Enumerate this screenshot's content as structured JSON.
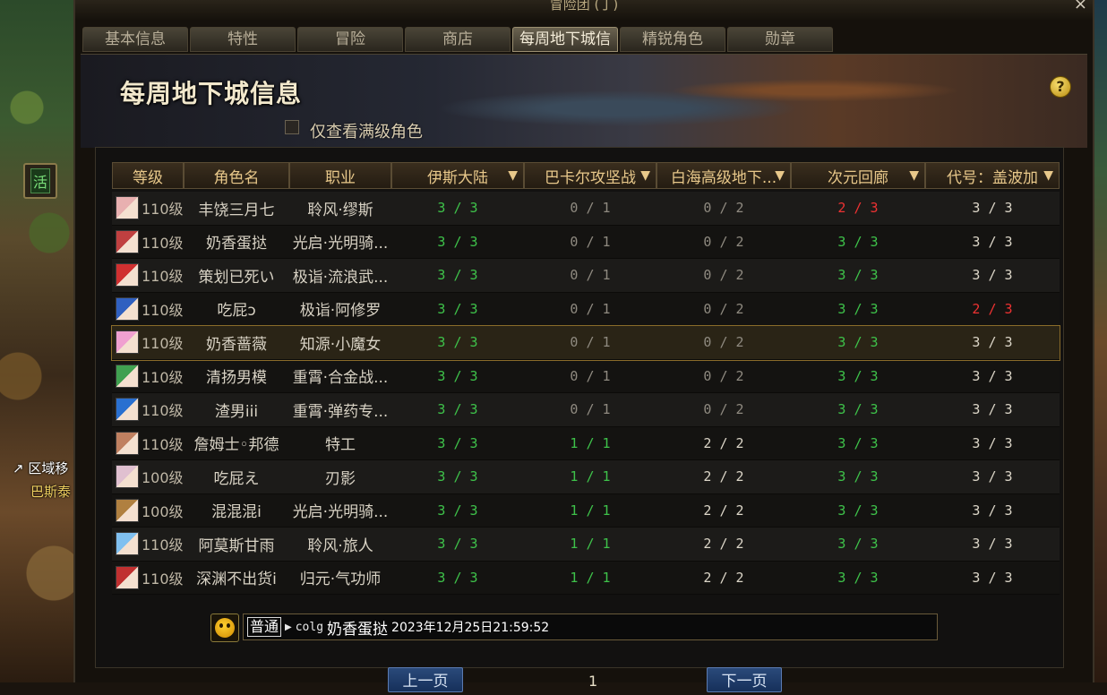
{
  "window": {
    "title": "冒险团 (丁)",
    "close_glyph": "×"
  },
  "tabs": [
    {
      "label": "基本信息",
      "active": false
    },
    {
      "label": "特性",
      "active": false
    },
    {
      "label": "冒险",
      "active": false
    },
    {
      "label": "商店",
      "active": false
    },
    {
      "label": "每周地下城信息",
      "active": true
    },
    {
      "label": "精锐角色",
      "active": false
    },
    {
      "label": "勋章",
      "active": false
    }
  ],
  "header": {
    "title": "每周地下城信息",
    "help_glyph": "?",
    "filter_label": "仅查看满级角色",
    "filter_checked": false
  },
  "columns": [
    "等级",
    "角色名",
    "职业",
    "伊斯大陆",
    "巴卡尔攻坚战",
    "白海高级地下...",
    "次元回廊",
    "代号：盖波加"
  ],
  "sortable_columns": [
    3,
    4,
    5,
    6,
    7
  ],
  "rows": [
    {
      "level": "110级",
      "name": "丰饶三月七",
      "job": "聆风·缪斯",
      "d1": "3 / 3",
      "d2": "0 / 1",
      "d3": "0 / 2",
      "d4": "2 / 3",
      "d5": "3 / 3",
      "avatar": "#e8b0b0"
    },
    {
      "level": "110级",
      "name": "奶香蛋挞",
      "job": "光启·光明骑...",
      "d1": "3 / 3",
      "d2": "0 / 1",
      "d3": "0 / 2",
      "d4": "3 / 3",
      "d5": "3 / 3",
      "avatar": "#c04040"
    },
    {
      "level": "110级",
      "name": "策划已死い",
      "job": "极诣·流浪武...",
      "d1": "3 / 3",
      "d2": "0 / 1",
      "d3": "0 / 2",
      "d4": "3 / 3",
      "d5": "3 / 3",
      "avatar": "#d03030"
    },
    {
      "level": "110级",
      "name": "吃屁ɔ",
      "job": "极诣·阿修罗",
      "d1": "3 / 3",
      "d2": "0 / 1",
      "d3": "0 / 2",
      "d4": "3 / 3",
      "d5": "2 / 3",
      "avatar": "#3060c0"
    },
    {
      "level": "110级",
      "name": "奶香蔷薇",
      "job": "知源·小魔女",
      "d1": "3 / 3",
      "d2": "0 / 1",
      "d3": "0 / 2",
      "d4": "3 / 3",
      "d5": "3 / 3",
      "avatar": "#f0a0d0",
      "selected": true
    },
    {
      "level": "110级",
      "name": "清扬男模",
      "job": "重霄·合金战...",
      "d1": "3 / 3",
      "d2": "0 / 1",
      "d3": "0 / 2",
      "d4": "3 / 3",
      "d5": "3 / 3",
      "avatar": "#40a050"
    },
    {
      "level": "110级",
      "name": "渣男iii",
      "job": "重霄·弹药专...",
      "d1": "3 / 3",
      "d2": "0 / 1",
      "d3": "0 / 2",
      "d4": "3 / 3",
      "d5": "3 / 3",
      "avatar": "#2a70d0"
    },
    {
      "level": "110级",
      "name": "詹姆士◦邦德",
      "job": "特工",
      "d1": "3 / 3",
      "d2": "1 / 1",
      "d3": "2 / 2",
      "d4": "3 / 3",
      "d5": "3 / 3",
      "avatar": "#c08060"
    },
    {
      "level": "100级",
      "name": "吃屁え",
      "job": "刃影",
      "d1": "3 / 3",
      "d2": "1 / 1",
      "d3": "2 / 2",
      "d4": "3 / 3",
      "d5": "3 / 3",
      "avatar": "#e0c0d0"
    },
    {
      "level": "100级",
      "name": "混混混i",
      "job": "光启·光明骑...",
      "d1": "3 / 3",
      "d2": "1 / 1",
      "d3": "2 / 2",
      "d4": "3 / 3",
      "d5": "3 / 3",
      "avatar": "#b08040"
    },
    {
      "level": "110级",
      "name": "阿莫斯甘雨",
      "job": "聆风·旅人",
      "d1": "3 / 3",
      "d2": "1 / 1",
      "d3": "2 / 2",
      "d4": "3 / 3",
      "d5": "3 / 3",
      "avatar": "#80c0f0"
    },
    {
      "level": "110级",
      "name": "深渊不出货i",
      "job": "归元·气功师",
      "d1": "3 / 3",
      "d2": "1 / 1",
      "d3": "2 / 2",
      "d4": "3 / 3",
      "d5": "3 / 3",
      "avatar": "#c03030"
    }
  ],
  "chat": {
    "channel": "普通",
    "arrow": "▶",
    "prefix": "colg",
    "name": "奶香蛋挞",
    "time": "2023年12月25日21:59:52"
  },
  "pager": {
    "prev": "上一页",
    "page": "1",
    "next": "下一页"
  },
  "hud": {
    "activity_badge": "活",
    "region_text": "区域移",
    "location_text": "巴斯泰"
  },
  "colors": {
    "complete": "#3ec24a",
    "incomplete": "#ee3232",
    "zero": "#8f8a80",
    "neutral": "#dcd6c8"
  }
}
